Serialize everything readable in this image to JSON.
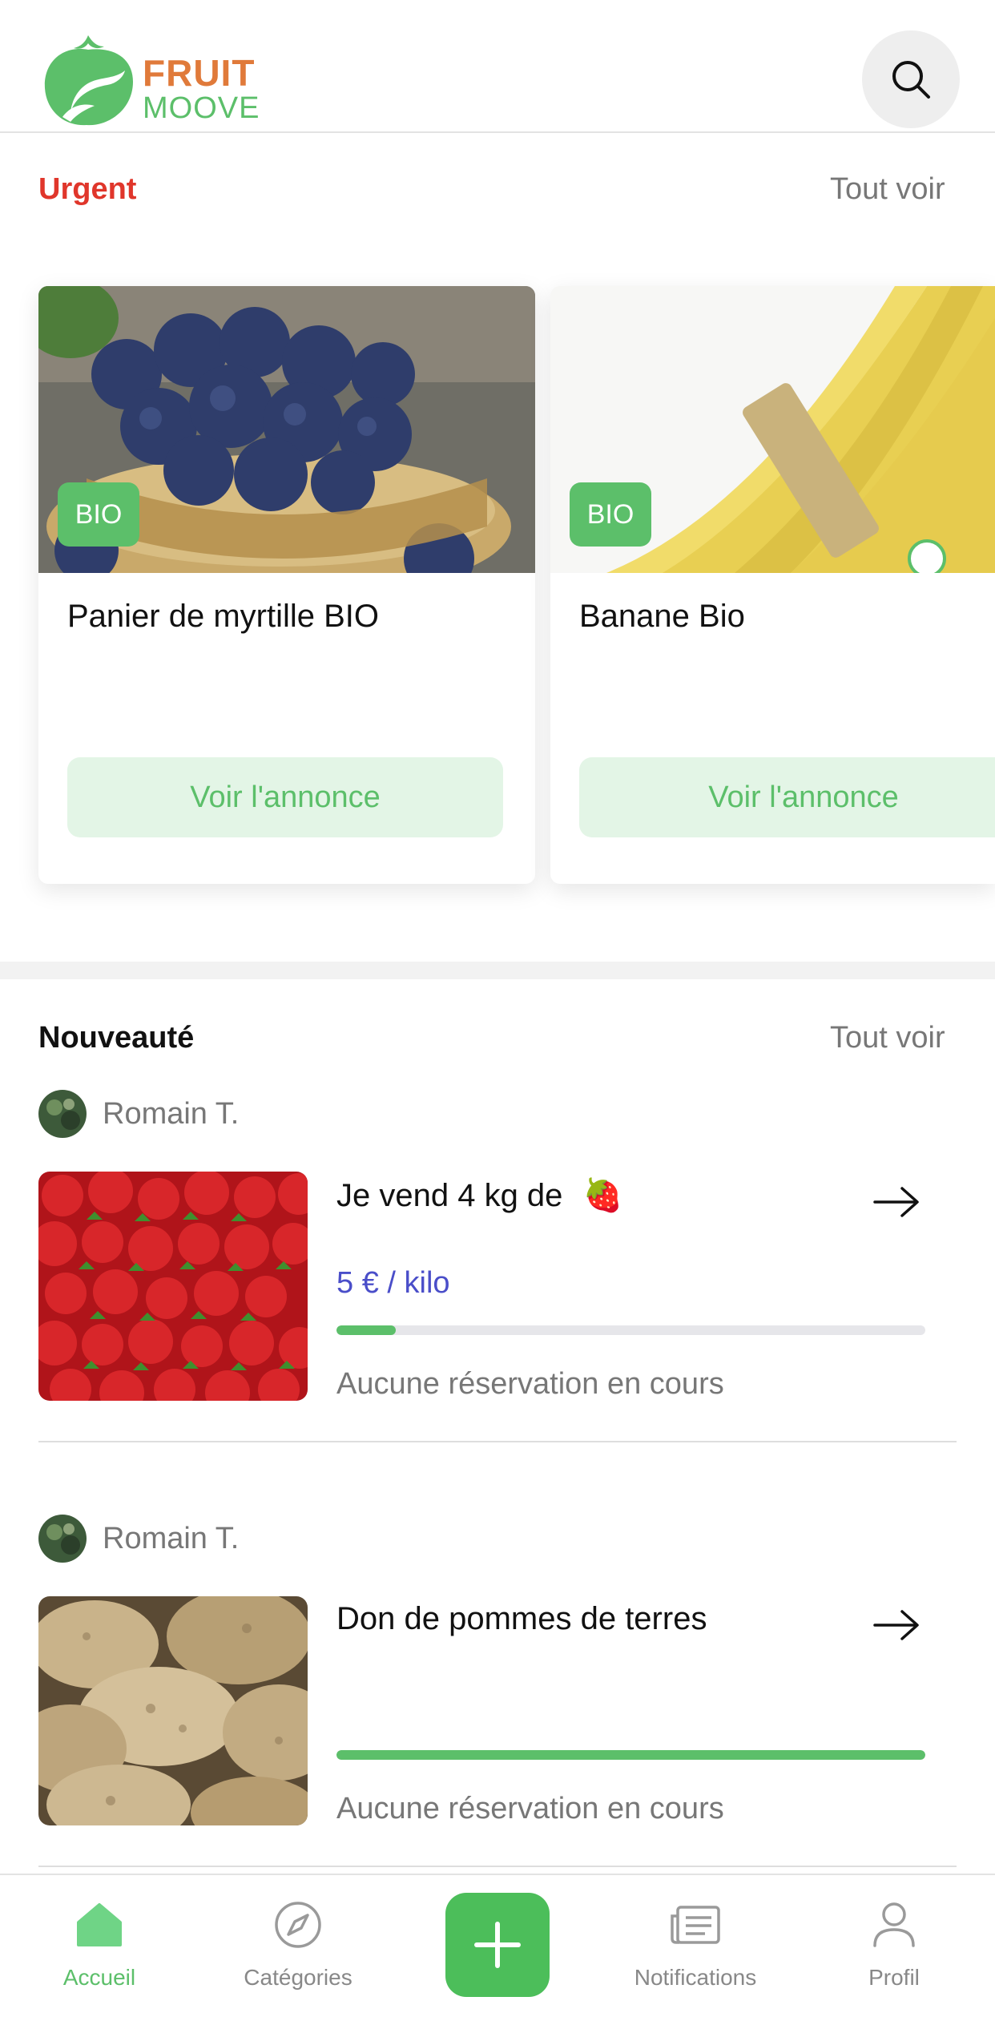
{
  "app": {
    "name_line1": "FRUIT",
    "name_line2": "MOOVE"
  },
  "colors": {
    "brand_green": "#5cbf6a",
    "brand_orange": "#e07a3a",
    "urgent_red": "#e0362b",
    "price_blue": "#4a4ec9"
  },
  "header": {
    "search_icon": "search-icon"
  },
  "urgent": {
    "title": "Urgent",
    "see_all": "Tout voir",
    "cards": [
      {
        "badge": "BIO",
        "title": "Panier de myrtille BIO",
        "button": "Voir l'annonce"
      },
      {
        "badge": "BIO",
        "title": "Banane Bio",
        "button": "Voir l'annonce"
      }
    ]
  },
  "news": {
    "title": "Nouveauté",
    "see_all": "Tout voir",
    "items": [
      {
        "author": "Romain T.",
        "title": "Je vend 4 kg de",
        "title_emoji": "🍓",
        "price": "5 € / kilo",
        "progress": 0.1,
        "status": "Aucune réservation en cours"
      },
      {
        "author": "Romain T.",
        "title": "Don de pommes de terres",
        "price": "",
        "progress": 1.0,
        "status": "Aucune réservation en cours"
      }
    ]
  },
  "tabbar": {
    "items": [
      {
        "label": "Accueil",
        "icon": "home-icon",
        "active": true
      },
      {
        "label": "Catégories",
        "icon": "compass-icon",
        "active": false
      },
      {
        "label": "",
        "icon": "plus-icon",
        "active": false
      },
      {
        "label": "Notifications",
        "icon": "newspaper-icon",
        "active": false
      },
      {
        "label": "Profil",
        "icon": "user-icon",
        "active": false
      }
    ]
  }
}
